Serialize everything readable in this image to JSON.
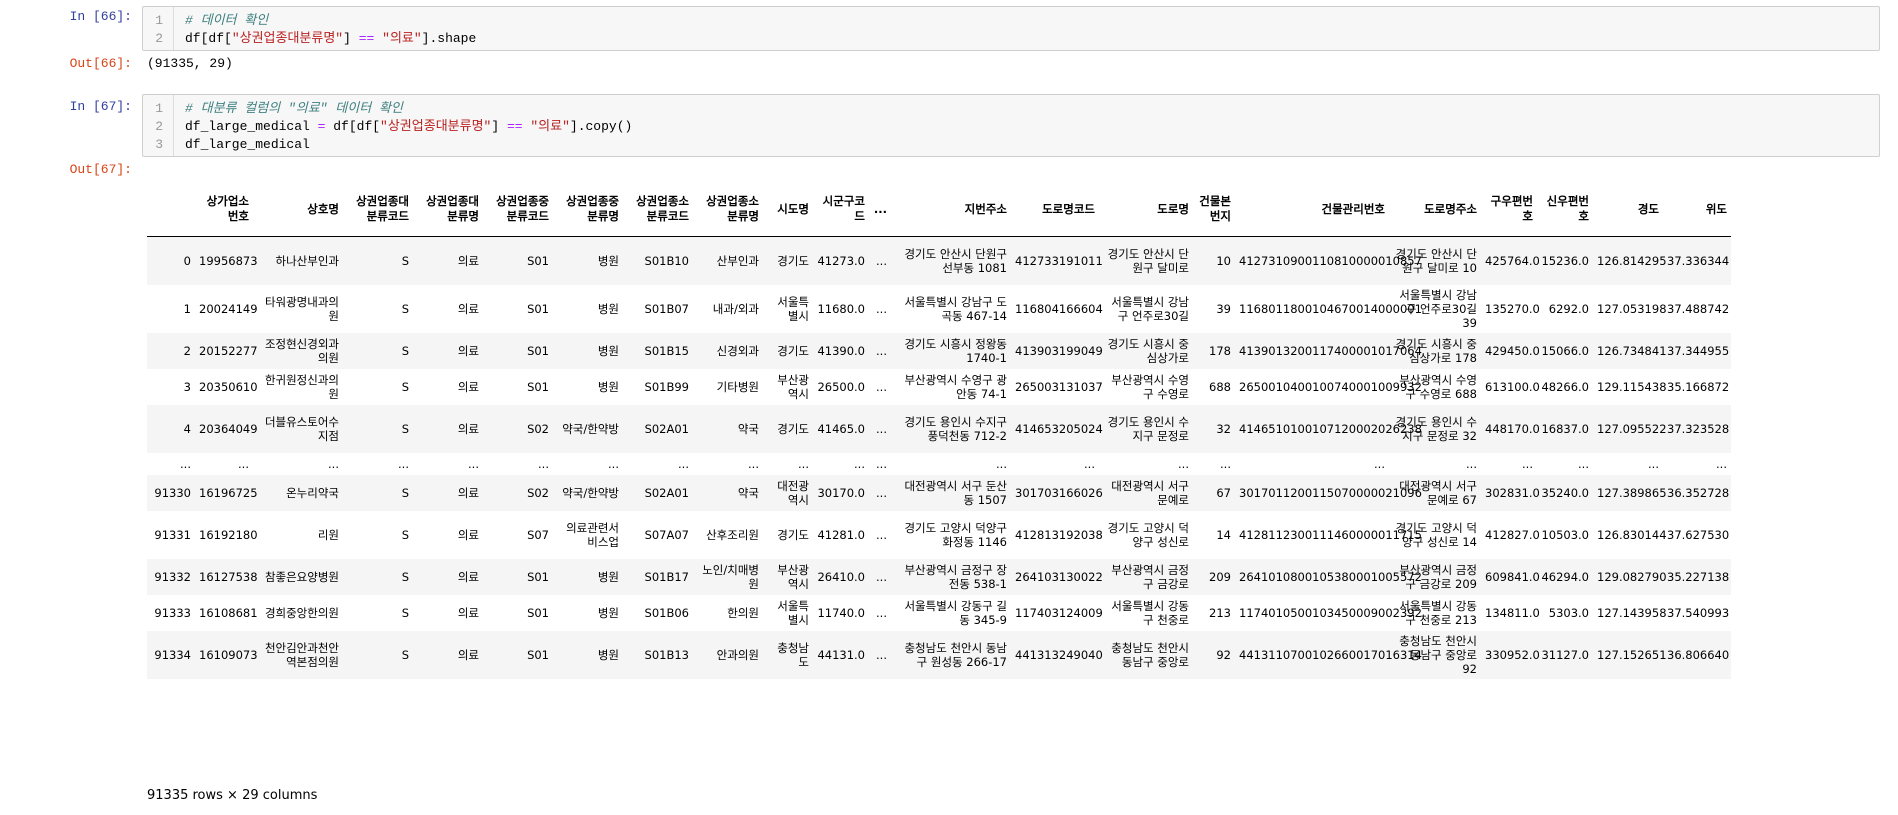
{
  "cell1": {
    "in_prompt": "In [66]:",
    "lines": [
      {
        "num": "1",
        "parts": [
          {
            "cls": "cm",
            "t": "# 데이터 확인"
          }
        ]
      },
      {
        "num": "2",
        "parts": [
          {
            "cls": "",
            "t": "df[df["
          },
          {
            "cls": "str",
            "t": "\"상권업종대분류명\""
          },
          {
            "cls": "",
            "t": "] "
          },
          {
            "cls": "op",
            "t": "=="
          },
          {
            "cls": "",
            "t": " "
          },
          {
            "cls": "str",
            "t": "\"의료\""
          },
          {
            "cls": "",
            "t": "].shape"
          }
        ]
      }
    ],
    "out_prompt": "Out[66]:",
    "output": "(91335, 29)"
  },
  "cell2": {
    "in_prompt": "In [67]:",
    "lines": [
      {
        "num": "1",
        "parts": [
          {
            "cls": "cm",
            "t": "# 대분류 컬럼의 \"의료\" 데이터 확인"
          }
        ]
      },
      {
        "num": "2",
        "parts": [
          {
            "cls": "",
            "t": "df_large_medical "
          },
          {
            "cls": "op",
            "t": "="
          },
          {
            "cls": "",
            "t": " df[df["
          },
          {
            "cls": "str",
            "t": "\"상권업종대분류명\""
          },
          {
            "cls": "",
            "t": "] "
          },
          {
            "cls": "op",
            "t": "=="
          },
          {
            "cls": "",
            "t": " "
          },
          {
            "cls": "str",
            "t": "\"의료\""
          },
          {
            "cls": "",
            "t": "].copy()"
          }
        ]
      },
      {
        "num": "3",
        "parts": [
          {
            "cls": "",
            "t": "df_large_medical"
          }
        ]
      }
    ],
    "out_prompt": "Out[67]:"
  },
  "dataframe": {
    "columns": [
      "",
      "상가업소번호",
      "상호명",
      "상권업종대분류코드",
      "상권업종대분류명",
      "상권업종중분류코드",
      "상권업종중분류명",
      "상권업종소분류코드",
      "상권업종소분류명",
      "시도명",
      "시군구코드",
      "...",
      "지번주소",
      "도로명코드",
      "도로명",
      "건물본번지",
      "건물관리번호",
      "도로명주소",
      "구우편번호",
      "신우편번호",
      "경도",
      "위도"
    ],
    "rows": [
      [
        "0",
        "19956873",
        "하나산부인과",
        "S",
        "의료",
        "S01",
        "병원",
        "S01B10",
        "산부인과",
        "경기도",
        "41273.0",
        "...",
        "경기도 안산시 단원구 선부동 1081",
        "412733191011",
        "경기도 안산시 단원구 달미로",
        "10",
        "4127310900110810000010857",
        "경기도 안산시 단원구 달미로 10",
        "425764.0",
        "15236.0",
        "126.814295",
        "37.336344"
      ],
      [
        "1",
        "20024149",
        "타워광명내과의원",
        "S",
        "의료",
        "S01",
        "병원",
        "S01B07",
        "내과/외과",
        "서울특별시",
        "11680.0",
        "...",
        "서울특별시 강남구 도곡동 467-14",
        "116804166604",
        "서울특별시 강남구 언주로30길",
        "39",
        "1168011800104670014000001",
        "서울특별시 강남구 언주로30길 39",
        "135270.0",
        "6292.0",
        "127.053198",
        "37.488742"
      ],
      [
        "2",
        "20152277",
        "조정현신경외과의원",
        "S",
        "의료",
        "S01",
        "병원",
        "S01B15",
        "신경외과",
        "경기도",
        "41390.0",
        "...",
        "경기도 시흥시 정왕동 1740-1",
        "413903199049",
        "경기도 시흥시 중심상가로",
        "178",
        "4139013200117400001017064",
        "경기도 시흥시 중심상가로 178",
        "429450.0",
        "15066.0",
        "126.734841",
        "37.344955"
      ],
      [
        "3",
        "20350610",
        "한귀원정신과의원",
        "S",
        "의료",
        "S01",
        "병원",
        "S01B99",
        "기타병원",
        "부산광역시",
        "26500.0",
        "...",
        "부산광역시 수영구 광안동 74-1",
        "265003131037",
        "부산광역시 수영구 수영로",
        "688",
        "2650010400100740001009932",
        "부산광역시 수영구 수영로 688",
        "613100.0",
        "48266.0",
        "129.115438",
        "35.166872"
      ],
      [
        "4",
        "20364049",
        "더블유스토어수지점",
        "S",
        "의료",
        "S02",
        "약국/한약방",
        "S02A01",
        "약국",
        "경기도",
        "41465.0",
        "...",
        "경기도 용인시 수지구 풍덕천동 712-2",
        "414653205024",
        "경기도 용인시 수지구 문정로",
        "32",
        "4146510100107120002026238",
        "경기도 용인시 수지구 문정로 32",
        "448170.0",
        "16837.0",
        "127.095522",
        "37.323528"
      ],
      [
        "...",
        "...",
        "...",
        "...",
        "...",
        "...",
        "...",
        "...",
        "...",
        "...",
        "...",
        "...",
        "...",
        "...",
        "...",
        "...",
        "...",
        "...",
        "...",
        "...",
        "...",
        "..."
      ],
      [
        "91330",
        "16196725",
        "온누리약국",
        "S",
        "의료",
        "S02",
        "약국/한약방",
        "S02A01",
        "약국",
        "대전광역시",
        "30170.0",
        "...",
        "대전광역시 서구 둔산동 1507",
        "301703166026",
        "대전광역시 서구 문예로",
        "67",
        "3017011200115070000021096",
        "대전광역시 서구 문예로 67",
        "302831.0",
        "35240.0",
        "127.389865",
        "36.352728"
      ],
      [
        "91331",
        "16192180",
        "리원",
        "S",
        "의료",
        "S07",
        "의료관련서비스업",
        "S07A07",
        "산후조리원",
        "경기도",
        "41281.0",
        "...",
        "경기도 고양시 덕양구 화정동 1146",
        "412813192038",
        "경기도 고양시 덕양구 성신로",
        "14",
        "4128112300111460000011715",
        "경기도 고양시 덕양구 성신로 14",
        "412827.0",
        "10503.0",
        "126.830144",
        "37.627530"
      ],
      [
        "91332",
        "16127538",
        "참좋은요양병원",
        "S",
        "의료",
        "S01",
        "병원",
        "S01B17",
        "노인/치매병원",
        "부산광역시",
        "26410.0",
        "...",
        "부산광역시 금정구 장전동 538-1",
        "264103130022",
        "부산광역시 금정구 금강로",
        "209",
        "2641010800105380001005572",
        "부산광역시 금정구 금강로 209",
        "609841.0",
        "46294.0",
        "129.082790",
        "35.227138"
      ],
      [
        "91333",
        "16108681",
        "경희중앙한의원",
        "S",
        "의료",
        "S01",
        "병원",
        "S01B06",
        "한의원",
        "서울특별시",
        "11740.0",
        "...",
        "서울특별시 강동구 길동 345-9",
        "117403124009",
        "서울특별시 강동구 천중로",
        "213",
        "1174010500103450009002392",
        "서울특별시 강동구 천중로 213",
        "134811.0",
        "5303.0",
        "127.143958",
        "37.540993"
      ],
      [
        "91334",
        "16109073",
        "천안김안과천안역본점의원",
        "S",
        "의료",
        "S01",
        "병원",
        "S01B13",
        "안과의원",
        "충청남도",
        "44131.0",
        "...",
        "충청남도 천안시 동남구 원성동 266-17",
        "441313249040",
        "충청남도 천안시 동남구 중앙로",
        "92",
        "4413110700102660017016314",
        "충청남도 천안시 동남구 중앙로 92",
        "330952.0",
        "31127.0",
        "127.152651",
        "36.806640"
      ]
    ],
    "footer": "91335 rows × 29 columns"
  }
}
